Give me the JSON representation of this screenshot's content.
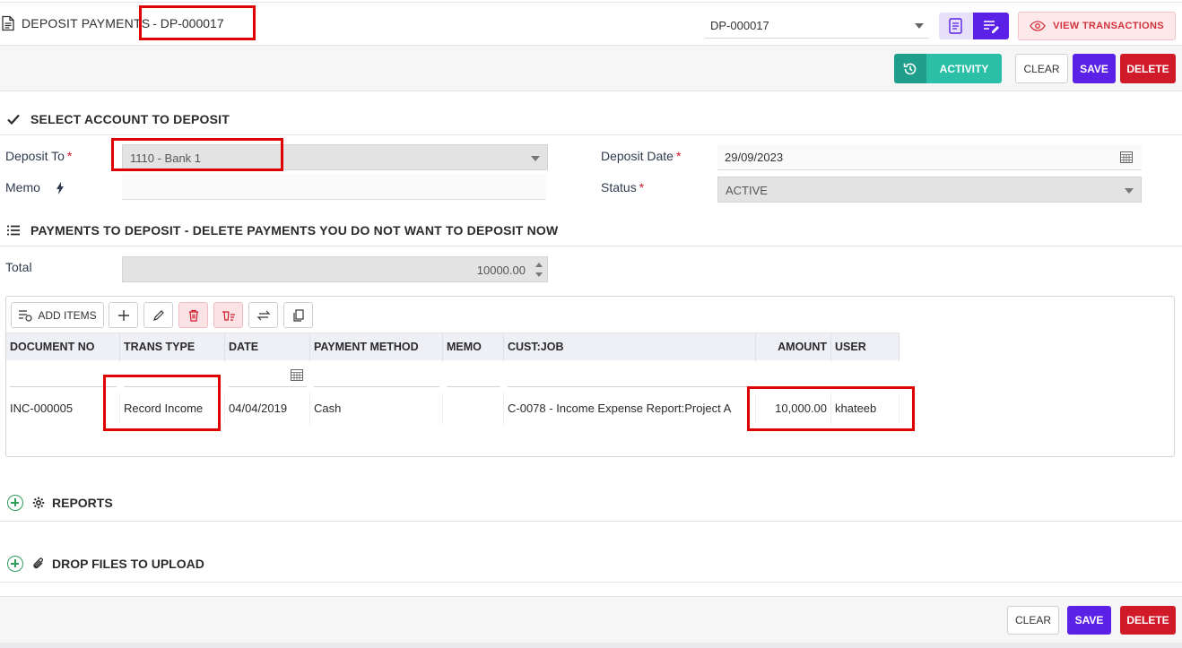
{
  "header": {
    "title_prefix": "DEPOSIT PAYMENTS",
    "title_docno": "- DP-000017",
    "doc_select_value": "DP-000017",
    "view_transactions_label": "VIEW TRANSACTIONS"
  },
  "toolbar": {
    "activity_label": "ACTIVITY",
    "clear_label": "CLEAR",
    "save_label": "SAVE",
    "delete_label": "DELETE"
  },
  "account_section": {
    "title": "SELECT ACCOUNT TO DEPOSIT",
    "deposit_to_label": "Deposit To",
    "deposit_to_value": "1110 - Bank 1",
    "memo_label": "Memo",
    "memo_value": "",
    "deposit_date_label": "Deposit Date",
    "deposit_date_value": "29/09/2023",
    "status_label": "Status",
    "status_value": "ACTIVE",
    "required_mark": "*"
  },
  "payments_section": {
    "title": "PAYMENTS TO DEPOSIT - DELETE PAYMENTS YOU DO NOT WANT TO DEPOSIT NOW",
    "total_label": "Total",
    "total_value": "10000.00",
    "add_items_label": "ADD ITEMS",
    "columns": [
      "DOCUMENT NO",
      "TRANS TYPE",
      "DATE",
      "PAYMENT METHOD",
      "MEMO",
      "CUST:JOB",
      "AMOUNT",
      "USER"
    ],
    "rows": [
      {
        "document_no": "INC-000005",
        "trans_type": "Record Income",
        "date": "04/04/2019",
        "payment_method": "Cash",
        "memo": "",
        "cust_job": "C-0078 - Income Expense Report:Project A",
        "amount": "10,000.00",
        "user": "khateeb"
      }
    ]
  },
  "reports_section": {
    "title": "REPORTS"
  },
  "files_section": {
    "title": "DROP FILES TO UPLOAD"
  },
  "footer": {
    "clear_label": "CLEAR",
    "save_label": "SAVE",
    "delete_label": "DELETE"
  },
  "colors": {
    "primary": "#5b21e6",
    "danger": "#d01a2a",
    "teal": "#2bbfa8",
    "highlight_box": "#e00000"
  }
}
